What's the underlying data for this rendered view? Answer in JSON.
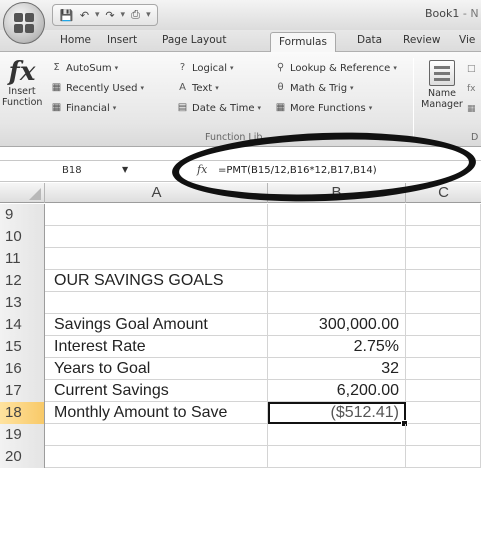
{
  "window": {
    "workbook_name": "Book1",
    "app_suffix": "- N"
  },
  "quick_access": {
    "save_icon": "save-icon",
    "undo_icon": "undo-icon",
    "redo_icon": "redo-icon",
    "print_icon": "print-icon"
  },
  "ribbon_tabs": [
    "Home",
    "Insert",
    "Page Layout",
    "Formulas",
    "Data",
    "Review",
    "Vie"
  ],
  "active_tab": "Formulas",
  "ribbon": {
    "insert_function_line1": "Insert",
    "insert_function_line2": "Function",
    "autosum": "AutoSum",
    "recently_used": "Recently Used",
    "financial": "Financial",
    "logical": "Logical",
    "text": "Text",
    "date_time": "Date & Time",
    "lookup_reference": "Lookup & Reference",
    "math_trig": "Math & Trig",
    "more_functions": "More Functions",
    "group_label": "Function Lib",
    "name_manager_line1": "Name",
    "name_manager_line2": "Manager",
    "defined_names_partial": "D"
  },
  "formula_bar": {
    "cell_ref": "B18",
    "fx_label": "fx",
    "formula": "=PMT(B15/12,B16*12,B17,B14)"
  },
  "columns": [
    "A",
    "B",
    "C"
  ],
  "rows": [
    {
      "num": "9",
      "a": "",
      "b": ""
    },
    {
      "num": "10",
      "a": "",
      "b": ""
    },
    {
      "num": "11",
      "a": "",
      "b": ""
    },
    {
      "num": "12",
      "a": "OUR SAVINGS GOALS",
      "b": ""
    },
    {
      "num": "13",
      "a": "",
      "b": ""
    },
    {
      "num": "14",
      "a": "Savings Goal Amount",
      "b": "300,000.00"
    },
    {
      "num": "15",
      "a": "Interest Rate",
      "b": "2.75%"
    },
    {
      "num": "16",
      "a": "Years to Goal",
      "b": "32"
    },
    {
      "num": "17",
      "a": "Current Savings",
      "b": "6,200.00"
    },
    {
      "num": "18",
      "a": "Monthly Amount to Save",
      "b": "($512.41)"
    },
    {
      "num": "19",
      "a": "",
      "b": ""
    },
    {
      "num": "20",
      "a": "",
      "b": ""
    }
  ],
  "selected_cell": "B18"
}
